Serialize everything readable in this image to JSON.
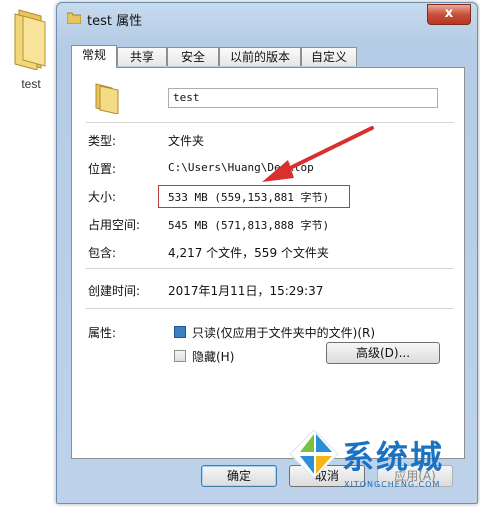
{
  "desktop": {
    "icon_label": "test"
  },
  "window": {
    "title": "test 属性",
    "close_glyph": "x",
    "tabs": [
      {
        "label": "常规"
      },
      {
        "label": "共享"
      },
      {
        "label": "安全"
      },
      {
        "label": "以前的版本"
      },
      {
        "label": "自定义"
      }
    ],
    "active_tab": "常规",
    "name_value": "test",
    "fields": {
      "type_label": "类型:",
      "type_value": "文件夹",
      "location_label": "位置:",
      "location_value": "C:\\Users\\Huang\\Desktop",
      "size_label": "大小:",
      "size_value": "533 MB (559,153,881 字节)",
      "disk_label": "占用空间:",
      "disk_value": "545 MB (571,813,888 字节)",
      "contains_label": "包含:",
      "contains_value": "4,217 个文件，559 个文件夹",
      "created_label": "创建时间:",
      "created_value": "2017年1月11日，15:29:37",
      "attributes_label": "属性:",
      "readonly_label": "只读(仅应用于文件夹中的文件)(R)",
      "hidden_label": "隐藏(H)",
      "advanced_label": "高级(D)..."
    },
    "buttons": {
      "ok": "确定",
      "cancel": "取消",
      "apply": "应用(A)"
    }
  },
  "watermark": {
    "brand": "系统城",
    "url": "XITONGCHENG.COM"
  },
  "colors": {
    "highlight_box": "#b5403f",
    "arrow": "#d8302f",
    "brand": "#1a72c2"
  }
}
